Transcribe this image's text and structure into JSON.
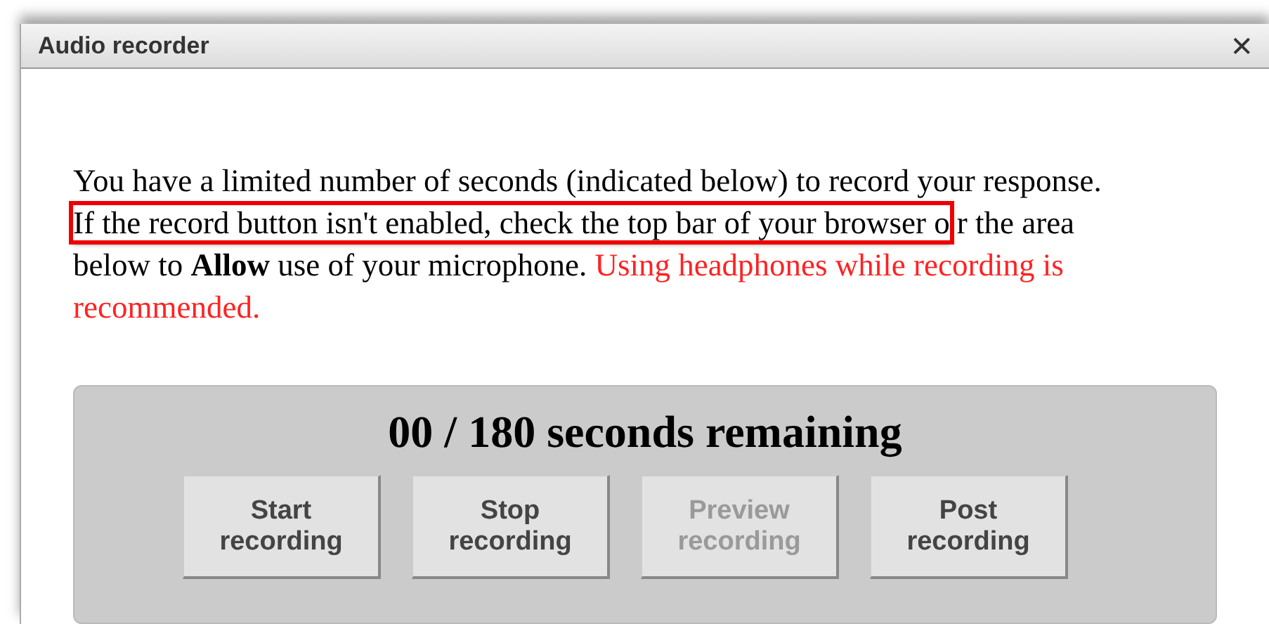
{
  "window": {
    "title": "Audio recorder",
    "close": "✕"
  },
  "instructions": {
    "before": "You have a limited number of seconds (indicated below) to record your response.",
    "highlighted": "If the record button isn't enabled, check the top bar of your browser o",
    "after": "r the area below to **Allow** use of your microphone.",
    "warning": "Using headphones while recording is recommended."
  },
  "timer": "00 / 180 seconds remaining",
  "buttons": [
    {
      "label": "Start recording",
      "disabled": false
    },
    {
      "label": "Stop recording",
      "disabled": false
    },
    {
      "label": "Preview recording",
      "disabled": true
    },
    {
      "label": "Post recording",
      "disabled": false
    }
  ]
}
